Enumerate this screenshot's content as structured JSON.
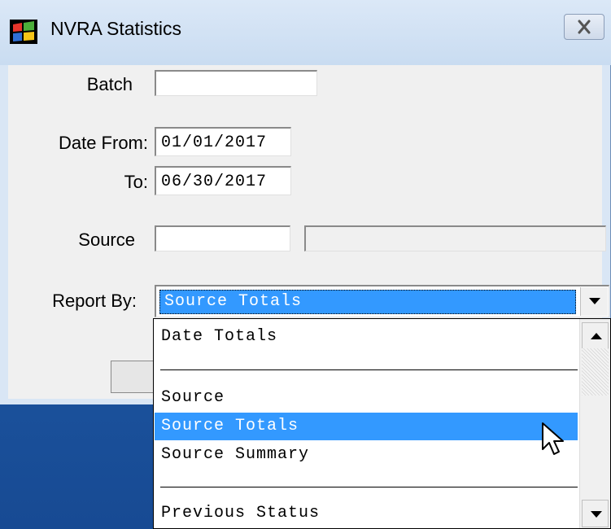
{
  "window": {
    "title": "NVRA Statistics",
    "app_icon": "windows-flag-icon",
    "close_icon": "close-icon"
  },
  "form": {
    "batch_label": "Batch",
    "batch_value": "",
    "date_from_label": "Date From:",
    "date_from_value": "01/01/2017",
    "date_to_label": "To:",
    "date_to_value": "06/30/2017",
    "source_label": "Source",
    "source_code_value": "",
    "source_desc_value": "",
    "report_by_label": "Report By:",
    "report_by_value": "Source Totals"
  },
  "dropdown": {
    "items": [
      {
        "label": "Date Totals",
        "type": "item"
      },
      {
        "label": "",
        "type": "separator"
      },
      {
        "label": "Source",
        "type": "item"
      },
      {
        "label": "Source Totals",
        "type": "item",
        "selected": true
      },
      {
        "label": "Source Summary",
        "type": "item"
      },
      {
        "label": "",
        "type": "separator"
      },
      {
        "label": "Previous Status",
        "type": "item"
      }
    ]
  },
  "colors": {
    "selection": "#3399ff",
    "desktop": "#1f5aa6",
    "titlebar": "#dbe8f7"
  }
}
